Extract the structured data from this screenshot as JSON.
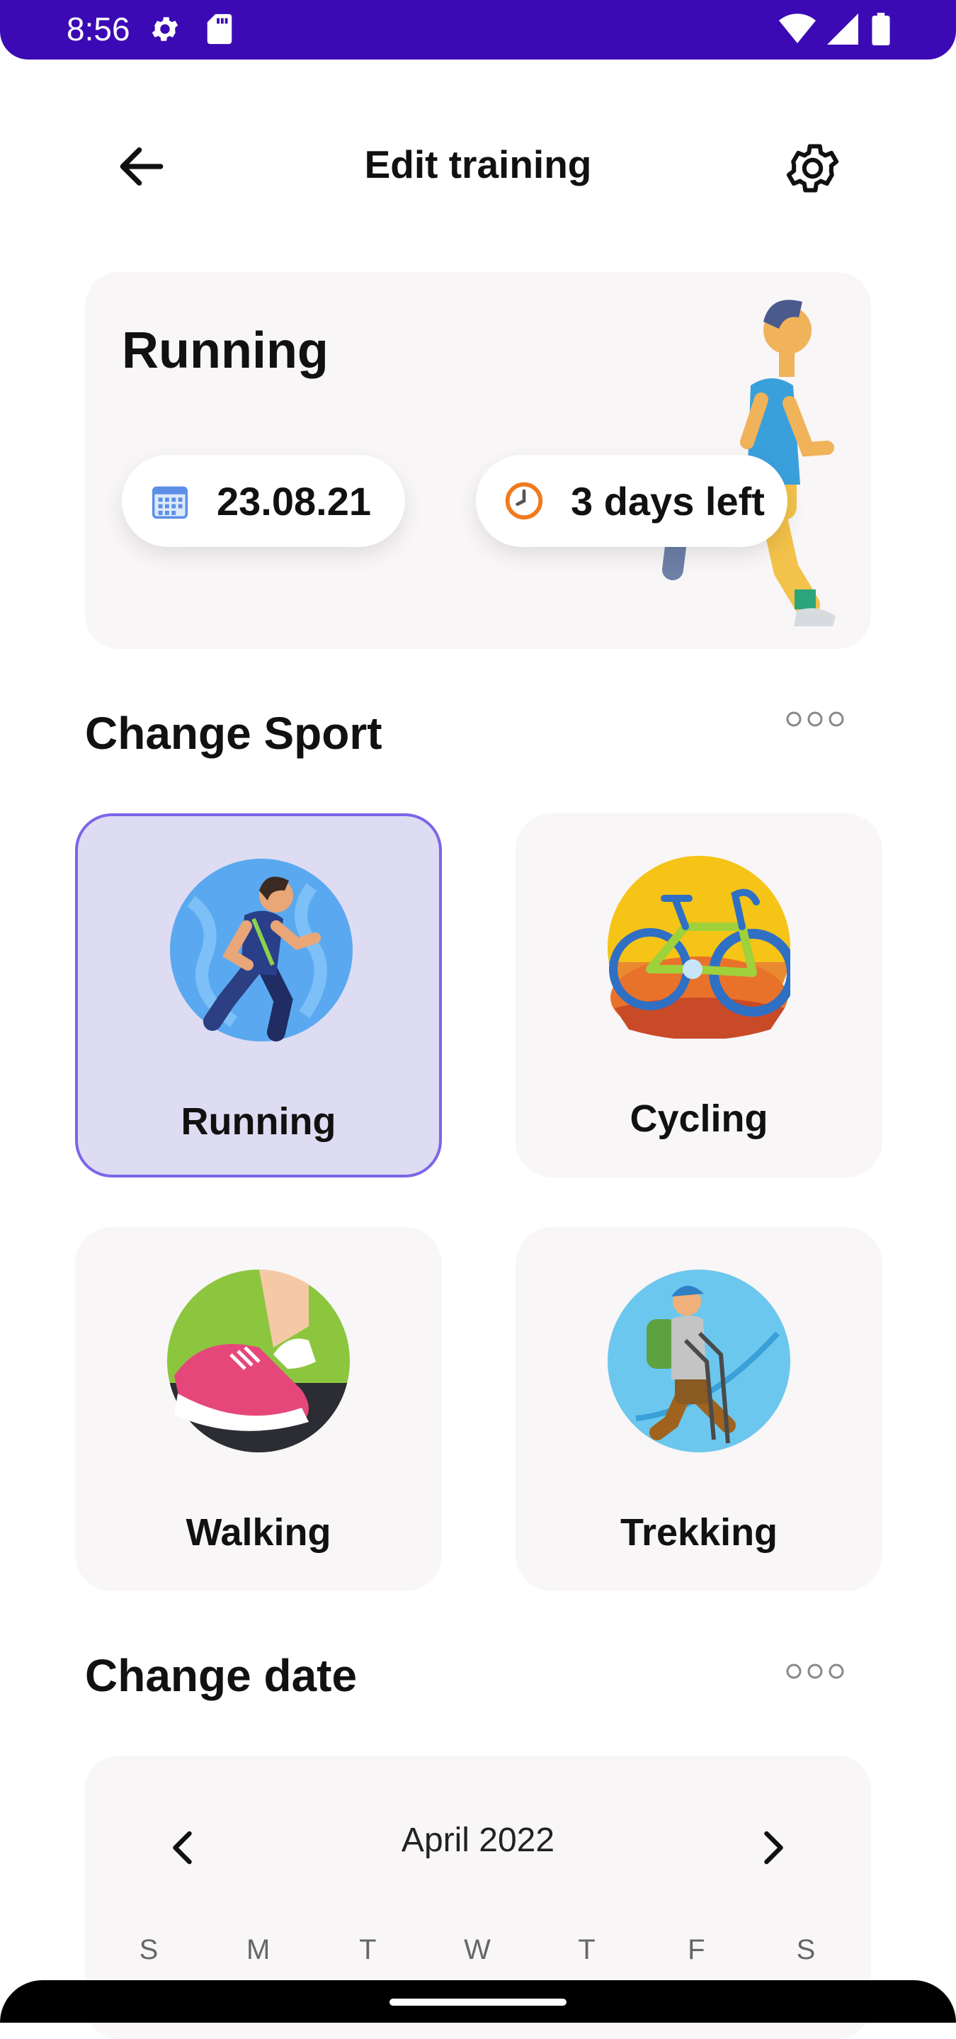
{
  "status_bar": {
    "time": "8:56",
    "background": "#3B0AB4",
    "left_icons": [
      "gear-icon",
      "sd-card-icon"
    ],
    "right_icons": [
      "wifi-icon",
      "signal-icon",
      "battery-icon"
    ]
  },
  "header": {
    "title": "Edit training",
    "back_icon": "arrow-left-icon",
    "settings_icon": "gear-icon"
  },
  "current_training": {
    "sport": "Running",
    "date": "23.08.21",
    "time_left": "3 days left",
    "date_icon": "calendar-icon",
    "time_icon": "clock-icon"
  },
  "change_sport": {
    "title": "Change Sport",
    "more_icon": "more-dots-icon",
    "selected": "Running",
    "sports": [
      {
        "label": "Running",
        "icon": "runner-icon"
      },
      {
        "label": "Cycling",
        "icon": "bicycle-icon"
      },
      {
        "label": "Walking",
        "icon": "sneaker-icon"
      },
      {
        "label": "Trekking",
        "icon": "hiker-icon"
      }
    ]
  },
  "change_date": {
    "title": "Change date",
    "more_icon": "more-dots-icon",
    "month": "April 2022",
    "weekdays": [
      "S",
      "M",
      "T",
      "W",
      "T",
      "F",
      "S"
    ]
  },
  "colors": {
    "accent": "#7B66E8",
    "selected_tile": "#DEDCF2",
    "card_bg": "#F8F6F7"
  }
}
